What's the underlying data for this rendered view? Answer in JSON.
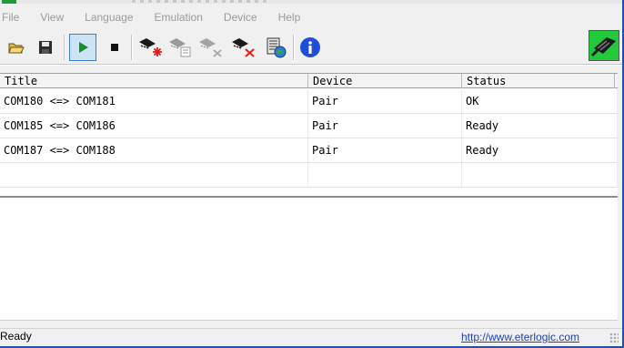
{
  "menu": [
    "File",
    "View",
    "Language",
    "Emulation",
    "Device",
    "Help"
  ],
  "toolbar": {
    "buttons": [
      {
        "name": "open-button",
        "icon": "open-folder-icon"
      },
      {
        "name": "save-button",
        "icon": "floppy-disk-icon"
      },
      {
        "name": "start-button",
        "icon": "play-icon",
        "active": true
      },
      {
        "name": "stop-button",
        "icon": "stop-icon"
      },
      {
        "name": "add-device-button",
        "icon": "add-device-icon"
      },
      {
        "name": "device-properties-button",
        "icon": "device-properties-icon"
      },
      {
        "name": "disconnect-device-button",
        "icon": "disconnect-device-icon"
      },
      {
        "name": "remove-device-button",
        "icon": "remove-device-icon"
      },
      {
        "name": "settings-button",
        "icon": "calculator-globe-icon"
      },
      {
        "name": "about-button",
        "icon": "info-icon"
      },
      {
        "name": "app-logo",
        "icon": "serial-port-logo-icon"
      }
    ]
  },
  "list": {
    "columns": [
      "Title",
      "Device",
      "Status"
    ],
    "rows": [
      {
        "title": "COM180 <=> COM181",
        "device": "Pair",
        "status": "OK"
      },
      {
        "title": "COM185 <=> COM186",
        "device": "Pair",
        "status": "Ready"
      },
      {
        "title": "COM187 <=> COM188",
        "device": "Pair",
        "status": "Ready"
      }
    ]
  },
  "statusbar": {
    "text": "Ready",
    "link": "http://www.eterlogic.com"
  },
  "colors": {
    "accent_blue": "#1f4fa8",
    "play_green": "#1a8a2a",
    "info_blue": "#1f4fd8",
    "logo_green": "#22c93a",
    "link_blue": "#1a3fbf"
  }
}
